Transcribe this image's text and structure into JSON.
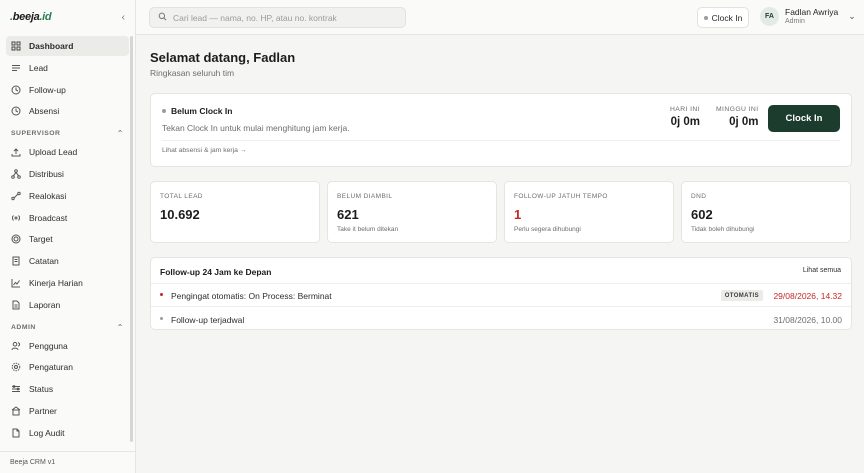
{
  "app": {
    "logo_main": "beeja",
    "logo_tld": ".id",
    "version": "Beeja CRM v1"
  },
  "colors": {
    "accent": "#1c3d2e",
    "danger": "#c62828",
    "brand": "#2e7d4f"
  },
  "sidebar": {
    "items_main": [
      {
        "label": "Dashboard",
        "icon": "grid-icon"
      },
      {
        "label": "Lead",
        "icon": "list-icon"
      },
      {
        "label": "Follow-up",
        "icon": "clock-icon"
      },
      {
        "label": "Absensi",
        "icon": "clock-icon"
      }
    ],
    "section_supervisor": "SUPERVISOR",
    "items_supervisor": [
      {
        "label": "Upload Lead",
        "icon": "upload-icon"
      },
      {
        "label": "Distribusi",
        "icon": "share-icon"
      },
      {
        "label": "Realokasi",
        "icon": "shuffle-icon"
      },
      {
        "label": "Broadcast",
        "icon": "broadcast-icon"
      },
      {
        "label": "Target",
        "icon": "target-icon"
      },
      {
        "label": "Catatan",
        "icon": "note-icon"
      },
      {
        "label": "Kinerja Harian",
        "icon": "chart-icon"
      },
      {
        "label": "Laporan",
        "icon": "report-icon"
      }
    ],
    "section_admin": "ADMIN",
    "items_admin": [
      {
        "label": "Pengguna",
        "icon": "users-icon"
      },
      {
        "label": "Pengaturan",
        "icon": "settings-icon"
      },
      {
        "label": "Status",
        "icon": "sliders-icon"
      },
      {
        "label": "Partner",
        "icon": "building-icon"
      },
      {
        "label": "Log Audit",
        "icon": "file-icon"
      }
    ]
  },
  "topbar": {
    "search_placeholder": "Cari lead — nama, no. HP, atau no. kontrak",
    "clock_label": "Clock In",
    "user_initials": "FA",
    "user_name": "Fadlan Awriya",
    "user_role": "Admin"
  },
  "main": {
    "greeting": "Selamat datang, Fadlan",
    "subtitle": "Ringkasan seluruh tim",
    "clock_card": {
      "title": "Belum Clock In",
      "desc": "Tekan Clock In untuk mulai menghitung jam kerja.",
      "link": "Lihat absensi & jam kerja →",
      "today_label": "HARI INI",
      "today_value": "0j 0m",
      "week_label": "MINGGU INI",
      "week_value": "0j 0m",
      "button": "Clock In"
    },
    "metrics": [
      {
        "label": "TOTAL LEAD",
        "value": "10.692",
        "desc": ""
      },
      {
        "label": "BELUM DIAMBIL",
        "value": "621",
        "desc": "Take it belum ditekan"
      },
      {
        "label": "FOLLOW-UP JATUH TEMPO",
        "value": "1",
        "desc": "Perlu segera dihubungi"
      },
      {
        "label": "DND",
        "value": "602",
        "desc": "Tidak boleh dihubungi"
      }
    ],
    "followup": {
      "title": "Follow-up 24 Jam ke Depan",
      "see_all": "Lihat semua",
      "rows": [
        {
          "text": "Pengingat otomatis: On Process: Berminat",
          "badge": "OTOMATIS",
          "time": "29/08/2026, 14.32"
        },
        {
          "text": "Follow-up terjadwal",
          "badge": "",
          "time": "31/08/2026, 10.00"
        }
      ]
    }
  }
}
